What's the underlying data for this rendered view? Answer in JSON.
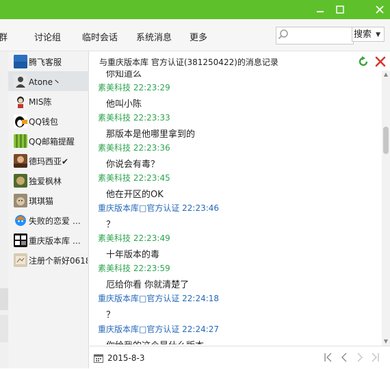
{
  "window": {
    "minimize_label": "—",
    "maximize_label": "☐",
    "close_label": "✕"
  },
  "tabs": [
    {
      "label": "群"
    },
    {
      "label": "讨论组"
    },
    {
      "label": "临时会话"
    },
    {
      "label": "系统消息"
    },
    {
      "label": "更多"
    }
  ],
  "search": {
    "placeholder": "",
    "button_label": "搜索"
  },
  "contacts": [
    {
      "name": "腾飞客服",
      "avatar_text": "腾飞\n科技",
      "avatar_color": "#2b6fc0"
    },
    {
      "name": "Atone丶",
      "avatar_text": "",
      "avatar_color": "#555555"
    },
    {
      "name": "MIS陈",
      "avatar_text": "",
      "avatar_color": "#d8d8d8"
    },
    {
      "name": "QQ钱包",
      "avatar_text": "",
      "avatar_color": "#222222"
    },
    {
      "name": "QQ邮箱提醒",
      "avatar_text": "",
      "avatar_color": "#7fb53a"
    },
    {
      "name": "德玛西亚✔",
      "avatar_text": "",
      "avatar_color": "#a0522d"
    },
    {
      "name": "独爱枫林",
      "avatar_text": "",
      "avatar_color": "#6b8e23"
    },
    {
      "name": "琪琪猫",
      "avatar_text": "",
      "avatar_color": "#8b7d6b"
    },
    {
      "name": "失败的恋爱 …",
      "avatar_text": "",
      "avatar_color": "#1e90ff"
    },
    {
      "name": "重庆版本库 …",
      "avatar_text": "重庆\n版本",
      "avatar_color": "#111111"
    },
    {
      "name": "注册个新好0618",
      "avatar_text": "",
      "avatar_color": "#c9b99a"
    }
  ],
  "chat": {
    "header": "与重庆版本库  官方认证(381250422)的消息记录",
    "messages": [
      {
        "type": "body",
        "text": "你知道么"
      },
      {
        "type": "green",
        "text": "素美科技  22:23:29"
      },
      {
        "type": "body",
        "text": "他叫小陈"
      },
      {
        "type": "green",
        "text": "素美科技  22:23:33"
      },
      {
        "type": "body",
        "text": "那版本是他哪里拿到的"
      },
      {
        "type": "green",
        "text": "素美科技  22:23:36"
      },
      {
        "type": "body",
        "text": "你说会有毒？"
      },
      {
        "type": "green",
        "text": "素美科技  22:23:45"
      },
      {
        "type": "body",
        "text": "他在开区的OK"
      },
      {
        "type": "blue",
        "text": "重庆版本库□官方认证  22:23:46"
      },
      {
        "type": "body",
        "text": "？"
      },
      {
        "type": "green",
        "text": "素美科技  22:23:49"
      },
      {
        "type": "body",
        "text": "十年版本的毒"
      },
      {
        "type": "green",
        "text": "素美科技  22:23:59"
      },
      {
        "type": "body",
        "text": "厄给你看 你就清楚了"
      },
      {
        "type": "blue",
        "text": "重庆版本库□官方认证  22:24:18"
      },
      {
        "type": "body",
        "text": "？"
      },
      {
        "type": "blue",
        "text": "重庆版本库□官方认证  22:24:27"
      },
      {
        "type": "body",
        "text": "你给我的这个是什么版本"
      }
    ]
  },
  "footer": {
    "date": "2015-8-3"
  },
  "colors": {
    "titlebar": "#5ec12b",
    "self_name": "#2ea44f",
    "other_name": "#2569b8"
  }
}
